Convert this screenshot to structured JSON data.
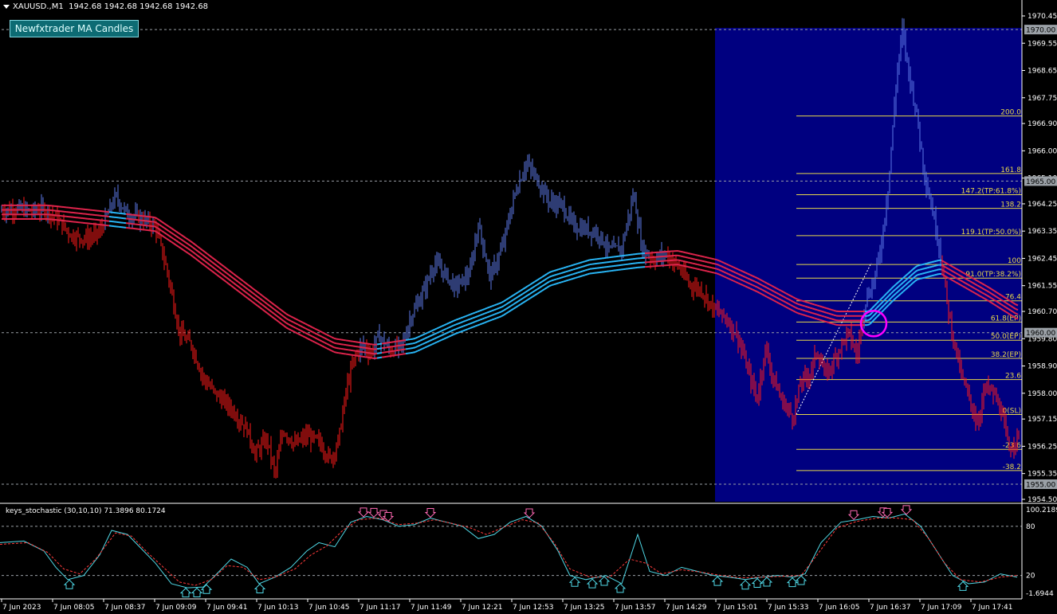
{
  "symbol": {
    "name": "XAUUSD.,M1",
    "ohlc": "1942.68 1942.68 1942.68 1942.68"
  },
  "indicator_badge": "Newfxtrader MA Candles",
  "subwindow": {
    "title": "keys_stochastic (30,10,10) 71.3896 80.1724",
    "y_labels": [
      "100.2189",
      "80",
      "20",
      "-1.6944"
    ]
  },
  "colors": {
    "bull": "#5b79e6",
    "bear": "#ff1a1a",
    "ma_bull": "#29b6f6",
    "ma_bear": "#e0244c",
    "fib": "#e8d84a",
    "highlight_box": "#000080",
    "circle": "#ff00ff",
    "axis": "#ffffff",
    "grid_dash": "#9aa0a6"
  },
  "chart_data": [
    {
      "type": "line",
      "title": "",
      "note": "gold price M1 candles with MA ribbons",
      "x_ticks": [
        "7 Jun 2023",
        "7 Jun 08:05",
        "7 Jun 08:37",
        "7 Jun 09:09",
        "7 Jun 09:41",
        "7 Jun 10:13",
        "7 Jun 10:45",
        "7 Jun 11:17",
        "7 Jun 11:49",
        "7 Jun 12:21",
        "7 Jun 12:53",
        "7 Jun 13:25",
        "7 Jun 13:57",
        "7 Jun 14:29",
        "7 Jun 15:01",
        "7 Jun 15:33",
        "7 Jun 16:05",
        "7 Jun 16:37",
        "7 Jun 17:09",
        "7 Jun 17:41"
      ],
      "y_ticks": [
        "1970.45",
        "1969.55",
        "1968.65",
        "1967.75",
        "1966.90",
        "1966.00",
        "1965.10",
        "1964.25",
        "1963.35",
        "1962.45",
        "1961.55",
        "1960.70",
        "1959.80",
        "1958.90",
        "1958.00",
        "1957.15",
        "1956.25",
        "1955.35",
        "1954.50"
      ],
      "ylim": [
        1954.3,
        1970.75
      ],
      "levels_highlighted": [
        "1970.00",
        "1965.00",
        "1960.00",
        "1955.00"
      ],
      "price_path": [
        [
          0,
          1964.0
        ],
        [
          20,
          1964.1
        ],
        [
          40,
          1964.0
        ],
        [
          55,
          1964.1
        ],
        [
          70,
          1963.8
        ],
        [
          90,
          1963.2
        ],
        [
          110,
          1963.1
        ],
        [
          125,
          1963.3
        ],
        [
          145,
          1964.5
        ],
        [
          160,
          1963.9
        ],
        [
          175,
          1963.8
        ],
        [
          195,
          1963.5
        ],
        [
          210,
          1962.0
        ],
        [
          225,
          1960.0
        ],
        [
          240,
          1959.6
        ],
        [
          255,
          1958.5
        ],
        [
          270,
          1958.0
        ],
        [
          290,
          1957.5
        ],
        [
          310,
          1956.8
        ],
        [
          320,
          1956.0
        ],
        [
          335,
          1956.5
        ],
        [
          345,
          1955.3
        ],
        [
          355,
          1956.8
        ],
        [
          370,
          1956.3
        ],
        [
          385,
          1956.6
        ],
        [
          400,
          1956.4
        ],
        [
          415,
          1955.8
        ],
        [
          425,
          1956.5
        ],
        [
          435,
          1958.2
        ],
        [
          445,
          1959.2
        ],
        [
          455,
          1959.6
        ],
        [
          465,
          1959.3
        ],
        [
          475,
          1959.9
        ],
        [
          490,
          1959.4
        ],
        [
          505,
          1959.6
        ],
        [
          515,
          1960.5
        ],
        [
          525,
          1961.0
        ],
        [
          535,
          1961.6
        ],
        [
          545,
          1962.3
        ],
        [
          560,
          1961.9
        ],
        [
          570,
          1961.5
        ],
        [
          580,
          1961.7
        ],
        [
          590,
          1962.0
        ],
        [
          600,
          1963.6
        ],
        [
          615,
          1961.8
        ],
        [
          630,
          1962.8
        ],
        [
          645,
          1964.5
        ],
        [
          660,
          1965.6
        ],
        [
          675,
          1965.0
        ],
        [
          690,
          1964.3
        ],
        [
          705,
          1964.2
        ],
        [
          720,
          1963.5
        ],
        [
          735,
          1963.4
        ],
        [
          750,
          1963.3
        ],
        [
          765,
          1962.7
        ],
        [
          780,
          1962.8
        ],
        [
          795,
          1964.6
        ],
        [
          805,
          1962.8
        ],
        [
          820,
          1962.4
        ],
        [
          835,
          1962.6
        ],
        [
          850,
          1962.2
        ],
        [
          865,
          1961.6
        ],
        [
          880,
          1961.4
        ],
        [
          895,
          1960.8
        ],
        [
          910,
          1960.5
        ],
        [
          925,
          1959.9
        ],
        [
          940,
          1958.6
        ],
        [
          950,
          1957.8
        ],
        [
          960,
          1959.5
        ],
        [
          970,
          1958.5
        ],
        [
          980,
          1957.8
        ],
        [
          995,
          1957.2
        ],
        [
          1005,
          1958.4
        ],
        [
          1015,
          1958.6
        ],
        [
          1025,
          1959.4
        ],
        [
          1035,
          1958.6
        ],
        [
          1045,
          1959.0
        ],
        [
          1055,
          1959.6
        ],
        [
          1065,
          1960.0
        ],
        [
          1075,
          1959.2
        ],
        [
          1085,
          1961.0
        ],
        [
          1095,
          1961.6
        ],
        [
          1105,
          1962.8
        ],
        [
          1115,
          1965.0
        ],
        [
          1125,
          1968.5
        ],
        [
          1132,
          1970.0
        ],
        [
          1140,
          1968.6
        ],
        [
          1150,
          1967.2
        ],
        [
          1160,
          1965.2
        ],
        [
          1170,
          1964.0
        ],
        [
          1180,
          1962.6
        ],
        [
          1188,
          1961.0
        ],
        [
          1196,
          1959.8
        ],
        [
          1206,
          1958.6
        ],
        [
          1216,
          1957.8
        ],
        [
          1226,
          1957.0
        ],
        [
          1236,
          1958.2
        ],
        [
          1246,
          1958.0
        ],
        [
          1256,
          1957.4
        ],
        [
          1266,
          1956.1
        ],
        [
          1276,
          1956.6
        ]
      ],
      "ma_path": [
        [
          0,
          1964.0
        ],
        [
          60,
          1964.0
        ],
        [
          130,
          1963.8
        ],
        [
          195,
          1963.6
        ],
        [
          240,
          1962.8
        ],
        [
          300,
          1961.6
        ],
        [
          360,
          1960.4
        ],
        [
          420,
          1959.6
        ],
        [
          470,
          1959.4
        ],
        [
          520,
          1959.6
        ],
        [
          570,
          1960.2
        ],
        [
          630,
          1960.8
        ],
        [
          690,
          1961.8
        ],
        [
          740,
          1962.2
        ],
        [
          800,
          1962.4
        ],
        [
          850,
          1962.5
        ],
        [
          900,
          1962.2
        ],
        [
          950,
          1961.6
        ],
        [
          1000,
          1960.9
        ],
        [
          1050,
          1960.5
        ],
        [
          1090,
          1960.5
        ],
        [
          1120,
          1961.3
        ],
        [
          1150,
          1962.0
        ],
        [
          1180,
          1962.2
        ],
        [
          1200,
          1961.9
        ],
        [
          1240,
          1961.3
        ],
        [
          1276,
          1960.7
        ]
      ],
      "fib_levels": [
        {
          "label": "200.0",
          "price": 1967.15
        },
        {
          "label": "161.8",
          "price": 1965.25
        },
        {
          "label": "147.2(TP:61.8%)",
          "price": 1964.55
        },
        {
          "label": "138.2",
          "price": 1964.1
        },
        {
          "label": "119.1(TP:50.0%)",
          "price": 1963.2
        },
        {
          "label": "100",
          "price": 1962.25
        },
        {
          "label": "91.0(TP:38.2%)",
          "price": 1961.8
        },
        {
          "label": "76.4",
          "price": 1961.05
        },
        {
          "label": "61.8(EP)",
          "price": 1960.35
        },
        {
          "label": "50.0(EP)",
          "price": 1959.75
        },
        {
          "label": "38.2(EP)",
          "price": 1959.15
        },
        {
          "label": "23.6",
          "price": 1958.45
        },
        {
          "label": "0(SL)",
          "price": 1957.3
        },
        {
          "label": "-23.6",
          "price": 1956.15
        },
        {
          "label": "-38.2",
          "price": 1955.45
        }
      ],
      "highlight_range": {
        "from_x": 897,
        "to_x": 1282
      }
    },
    {
      "type": "line",
      "title": "keys_stochastic (30,10,10)",
      "ylim": [
        -1.6944,
        100.2189
      ],
      "levels": [
        80,
        20
      ],
      "series": [
        {
          "name": "main",
          "points": [
            [
              0,
              60
            ],
            [
              30,
              62
            ],
            [
              55,
              50
            ],
            [
              70,
              30
            ],
            [
              85,
              15
            ],
            [
              105,
              20
            ],
            [
              125,
              45
            ],
            [
              140,
              75
            ],
            [
              160,
              70
            ],
            [
              180,
              50
            ],
            [
              195,
              35
            ],
            [
              215,
              10
            ],
            [
              235,
              5
            ],
            [
              255,
              6
            ],
            [
              270,
              20
            ],
            [
              290,
              40
            ],
            [
              310,
              30
            ],
            [
              325,
              10
            ],
            [
              345,
              18
            ],
            [
              365,
              30
            ],
            [
              385,
              50
            ],
            [
              400,
              60
            ],
            [
              420,
              55
            ],
            [
              440,
              85
            ],
            [
              460,
              92
            ],
            [
              480,
              88
            ],
            [
              500,
              80
            ],
            [
              520,
              82
            ],
            [
              540,
              90
            ],
            [
              560,
              85
            ],
            [
              580,
              80
            ],
            [
              600,
              65
            ],
            [
              620,
              70
            ],
            [
              640,
              85
            ],
            [
              660,
              92
            ],
            [
              680,
              80
            ],
            [
              700,
              50
            ],
            [
              715,
              20
            ],
            [
              735,
              15
            ],
            [
              760,
              20
            ],
            [
              780,
              10
            ],
            [
              800,
              70
            ],
            [
              815,
              25
            ],
            [
              835,
              20
            ],
            [
              855,
              30
            ],
            [
              875,
              25
            ],
            [
              895,
              20
            ],
            [
              915,
              18
            ],
            [
              935,
              15
            ],
            [
              955,
              18
            ],
            [
              975,
              20
            ],
            [
              995,
              18
            ],
            [
              1010,
              22
            ],
            [
              1030,
              60
            ],
            [
              1055,
              85
            ],
            [
              1075,
              88
            ],
            [
              1095,
              92
            ],
            [
              1115,
              90
            ],
            [
              1135,
              95
            ],
            [
              1155,
              80
            ],
            [
              1175,
              50
            ],
            [
              1195,
              20
            ],
            [
              1215,
              10
            ],
            [
              1235,
              12
            ],
            [
              1255,
              22
            ],
            [
              1276,
              18
            ]
          ]
        },
        {
          "name": "signal",
          "points": [
            [
              0,
              58
            ],
            [
              35,
              60
            ],
            [
              60,
              48
            ],
            [
              80,
              28
            ],
            [
              100,
              22
            ],
            [
              120,
              40
            ],
            [
              145,
              72
            ],
            [
              165,
              68
            ],
            [
              185,
              48
            ],
            [
              205,
              30
            ],
            [
              225,
              12
            ],
            [
              245,
              8
            ],
            [
              265,
              15
            ],
            [
              285,
              32
            ],
            [
              305,
              30
            ],
            [
              325,
              15
            ],
            [
              345,
              18
            ],
            [
              370,
              28
            ],
            [
              390,
              45
            ],
            [
              410,
              56
            ],
            [
              430,
              75
            ],
            [
              450,
              88
            ],
            [
              475,
              90
            ],
            [
              500,
              82
            ],
            [
              525,
              84
            ],
            [
              545,
              88
            ],
            [
              565,
              84
            ],
            [
              590,
              78
            ],
            [
              610,
              70
            ],
            [
              630,
              78
            ],
            [
              655,
              88
            ],
            [
              675,
              84
            ],
            [
              695,
              60
            ],
            [
              715,
              28
            ],
            [
              740,
              18
            ],
            [
              765,
              18
            ],
            [
              790,
              40
            ],
            [
              810,
              35
            ],
            [
              830,
              22
            ],
            [
              855,
              27
            ],
            [
              880,
              24
            ],
            [
              905,
              20
            ],
            [
              930,
              17
            ],
            [
              955,
              18
            ],
            [
              980,
              19
            ],
            [
              1005,
              20
            ],
            [
              1025,
              45
            ],
            [
              1050,
              78
            ],
            [
              1075,
              86
            ],
            [
              1100,
              90
            ],
            [
              1125,
              90
            ],
            [
              1145,
              88
            ],
            [
              1165,
              65
            ],
            [
              1185,
              35
            ],
            [
              1205,
              15
            ],
            [
              1230,
              12
            ],
            [
              1255,
              18
            ],
            [
              1276,
              20
            ]
          ]
        }
      ],
      "arrows_down": [
        456,
        469,
        481,
        487,
        540,
        664,
        1071,
        1108,
        1113,
        1137
      ],
      "arrows_up": [
        87,
        233,
        247,
        259,
        326,
        721,
        743,
        758,
        778,
        900,
        935,
        950,
        962,
        994,
        1005,
        1208
      ]
    }
  ]
}
